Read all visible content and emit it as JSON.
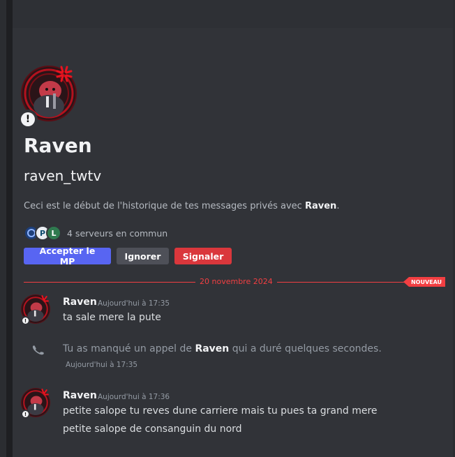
{
  "profile": {
    "display_name": "Raven",
    "username": "raven_twtv",
    "intro_prefix": "Ceci est le début de l'historique de tes messages privés avec ",
    "intro_name": "Raven",
    "intro_suffix": ".",
    "status_icon": "idle-exclamation-icon",
    "mutual_servers_text": "4 serveurs en commun",
    "mutual_server_icons": [
      "server-icon-blue",
      "server-icon-p",
      "server-icon-l"
    ]
  },
  "actions": {
    "accept_label": "Accepter le MP",
    "ignore_label": "Ignorer",
    "report_label": "Signaler"
  },
  "divider": {
    "date": "20 novembre 2024",
    "new_badge": "NOUVEAU"
  },
  "messages": [
    {
      "author": "Raven",
      "time": "Aujourd'hui à 17:35",
      "lines": [
        "ta sale mere la pute"
      ]
    },
    {
      "type": "call",
      "text_prefix": "Tu as manqué un appel de ",
      "text_name": "Raven",
      "text_suffix": " qui a duré quelques secondes.",
      "time": "Aujourd'hui à 17:35"
    },
    {
      "author": "Raven",
      "time": "Aujourd'hui à 17:36",
      "lines": [
        "petite salope tu reves dune carriere mais tu pues ta grand mere",
        "petite salope de consanguin du nord"
      ]
    }
  ],
  "colors": {
    "background": "#313338",
    "accent": "#5865f2",
    "danger": "#da373c",
    "new_line": "#f23f42"
  }
}
